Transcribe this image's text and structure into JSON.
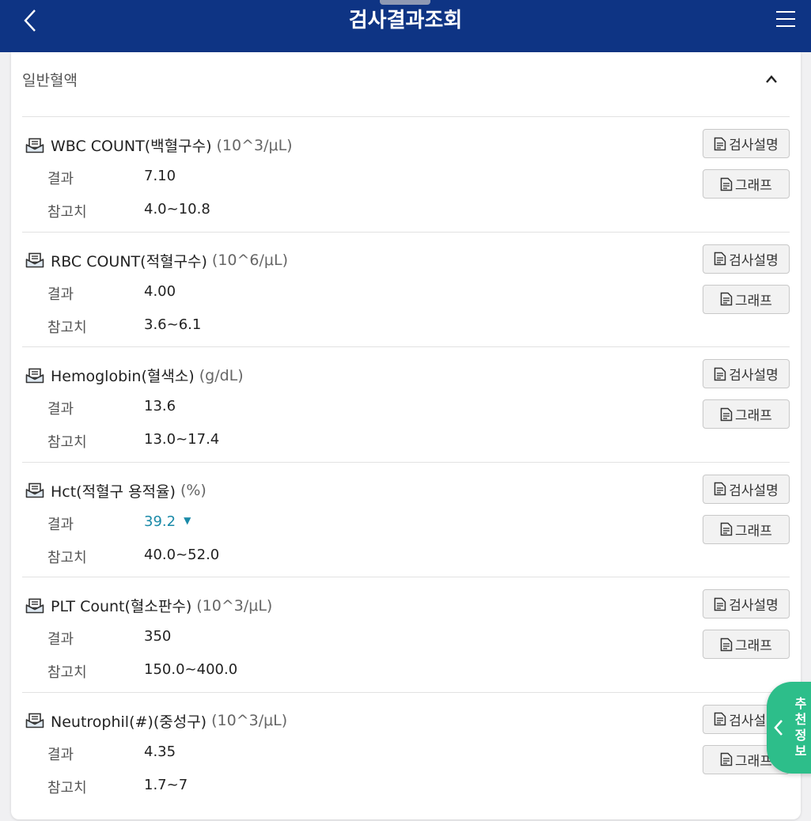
{
  "header": {
    "title": "검사결과조회"
  },
  "section": {
    "title": "일반혈액"
  },
  "labels": {
    "result": "결과",
    "reference": "참고치"
  },
  "buttons": {
    "description": "검사설명",
    "graph": "그래프"
  },
  "items": [
    {
      "name": "WBC COUNT(백혈구수)",
      "unit": "(10^3/μL)",
      "result": "7.10",
      "reference": "4.0~10.8",
      "flag": ""
    },
    {
      "name": "RBC COUNT(적혈구수)",
      "unit": "(10^6/μL)",
      "result": "4.00",
      "reference": "3.6~6.1",
      "flag": ""
    },
    {
      "name": "Hemoglobin(혈색소)",
      "unit": "(g/dL)",
      "result": "13.6",
      "reference": "13.0~17.4",
      "flag": ""
    },
    {
      "name": "Hct(적혈구 용적율)",
      "unit": "(%)",
      "result": "39.2",
      "reference": "40.0~52.0",
      "flag": "▼"
    },
    {
      "name": "PLT Count(혈소판수)",
      "unit": "(10^3/μL)",
      "result": "350",
      "reference": "150.0~400.0",
      "flag": ""
    },
    {
      "name": "Neutrophil(#)(중성구)",
      "unit": "(10^3/μL)",
      "result": "4.35",
      "reference": "1.7~7",
      "flag": ""
    }
  ],
  "fab": {
    "label": "추천정보"
  },
  "colors": {
    "header_bg": "#0e3484",
    "low_value": "#1a8aa8",
    "fab_bg": "#2dbe8a"
  },
  "icons": {
    "back": "chevron-left-icon",
    "menu": "hamburger-menu-icon",
    "collapse": "chevron-up-icon",
    "item": "document-envelope-icon",
    "button": "document-icon"
  }
}
